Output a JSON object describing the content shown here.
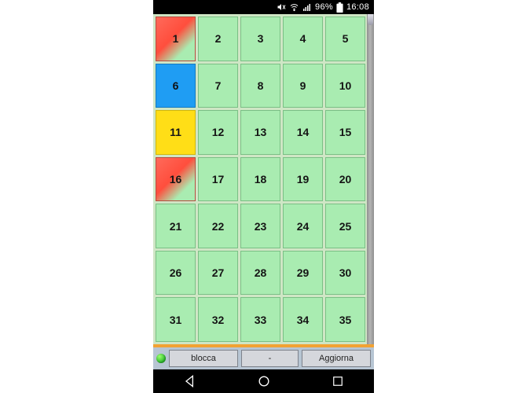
{
  "status_bar": {
    "battery_percent": "96%",
    "time": "16:08"
  },
  "grid": {
    "cells": [
      {
        "label": "1",
        "state": "red"
      },
      {
        "label": "2",
        "state": "green"
      },
      {
        "label": "3",
        "state": "green"
      },
      {
        "label": "4",
        "state": "green"
      },
      {
        "label": "5",
        "state": "green"
      },
      {
        "label": "6",
        "state": "blue"
      },
      {
        "label": "7",
        "state": "green"
      },
      {
        "label": "8",
        "state": "green"
      },
      {
        "label": "9",
        "state": "green"
      },
      {
        "label": "10",
        "state": "green"
      },
      {
        "label": "11",
        "state": "yellow"
      },
      {
        "label": "12",
        "state": "green"
      },
      {
        "label": "13",
        "state": "green"
      },
      {
        "label": "14",
        "state": "green"
      },
      {
        "label": "15",
        "state": "green"
      },
      {
        "label": "16",
        "state": "red"
      },
      {
        "label": "17",
        "state": "green"
      },
      {
        "label": "18",
        "state": "green"
      },
      {
        "label": "19",
        "state": "green"
      },
      {
        "label": "20",
        "state": "green"
      },
      {
        "label": "21",
        "state": "green"
      },
      {
        "label": "22",
        "state": "green"
      },
      {
        "label": "23",
        "state": "green"
      },
      {
        "label": "24",
        "state": "green"
      },
      {
        "label": "25",
        "state": "green"
      },
      {
        "label": "26",
        "state": "green"
      },
      {
        "label": "27",
        "state": "green"
      },
      {
        "label": "28",
        "state": "green"
      },
      {
        "label": "29",
        "state": "green"
      },
      {
        "label": "30",
        "state": "green"
      },
      {
        "label": "31",
        "state": "green"
      },
      {
        "label": "32",
        "state": "green"
      },
      {
        "label": "33",
        "state": "green"
      },
      {
        "label": "34",
        "state": "green"
      },
      {
        "label": "35",
        "state": "green"
      }
    ]
  },
  "toolbar": {
    "lock_label": "blocca",
    "middle_label": "-",
    "refresh_label": "Aggiorna"
  }
}
